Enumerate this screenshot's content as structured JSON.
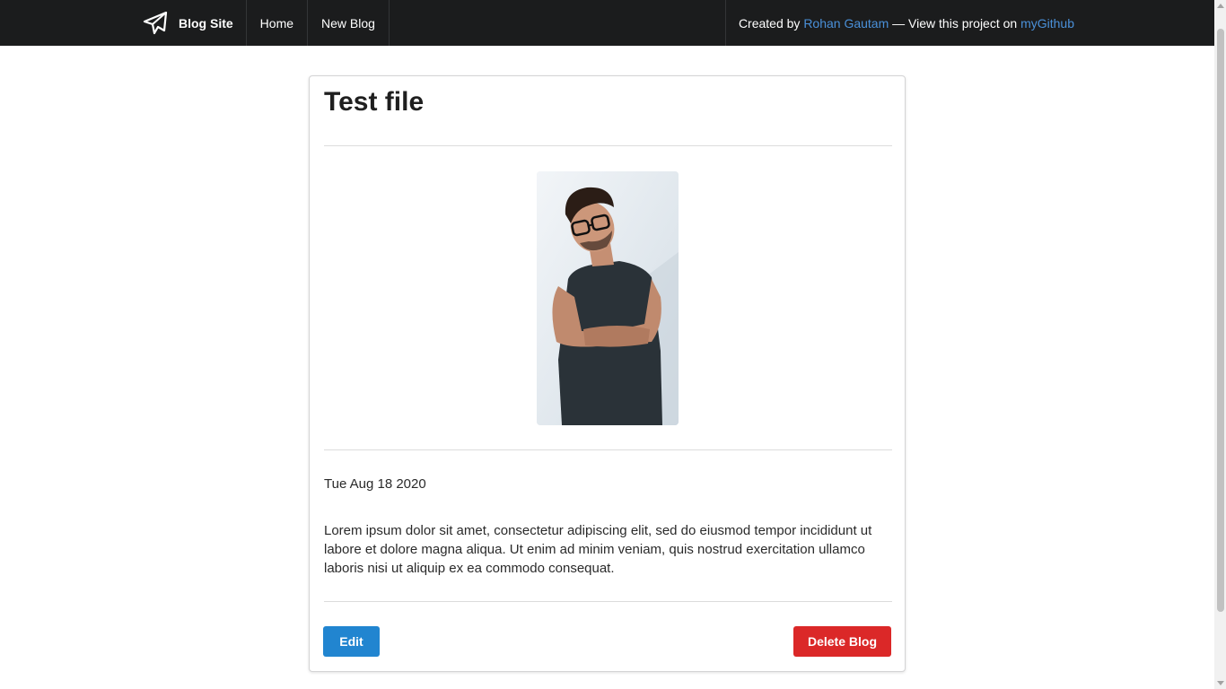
{
  "navbar": {
    "brand": "Blog Site",
    "links": [
      "Home",
      "New Blog"
    ],
    "credit_prefix": "Created by",
    "author": "Rohan Gautam",
    "credit_middle": "— View this project on",
    "github": "myGithub"
  },
  "post": {
    "title": "Test file",
    "date": "Tue Aug 18 2020",
    "body": "Lorem ipsum dolor sit amet, consectetur adipiscing elit, sed do eiusmod tempor incididunt ut labore et dolore magna aliqua. Ut enim ad minim veniam, quis nostrud exercitation ullamco laboris nisi ut aliquip ex ea commodo consequat.",
    "edit_label": "Edit",
    "delete_label": "Delete Blog"
  },
  "colors": {
    "navbar_bg": "#1b1c1d",
    "link": "#4a90d9",
    "edit_button": "#2185d0",
    "delete_button": "#db2828"
  },
  "icons": {
    "brand": "paper-plane-icon"
  }
}
